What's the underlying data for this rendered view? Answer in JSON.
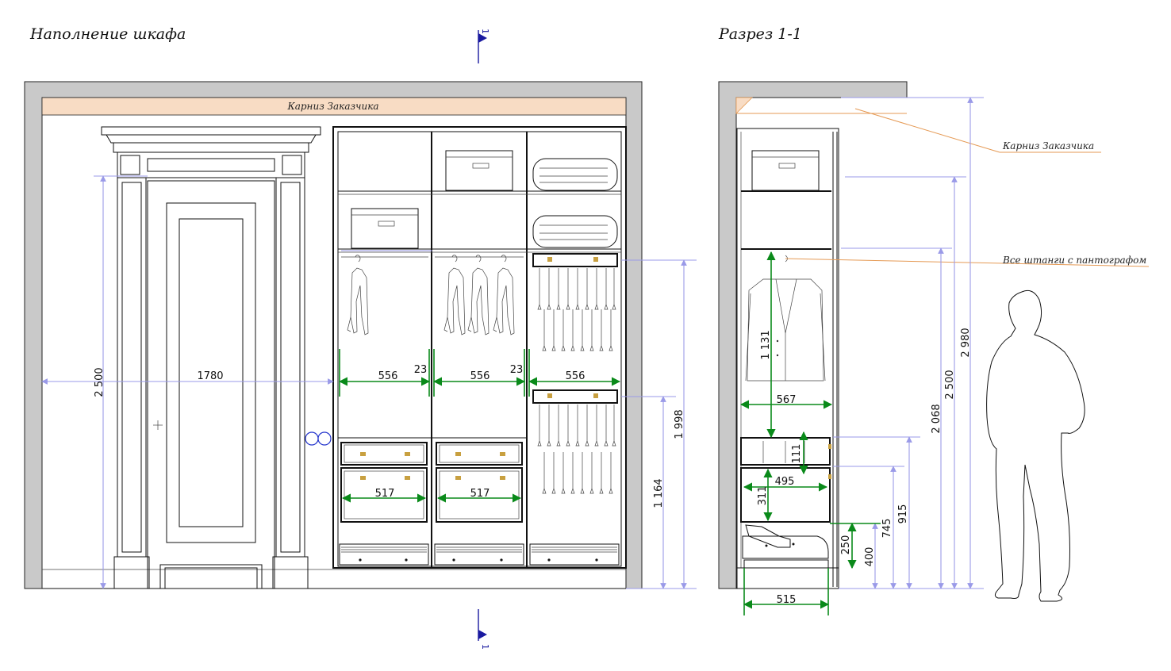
{
  "titles": {
    "elevation": "Наполнение шкафа",
    "section": "Разрез 1-1"
  },
  "section_marker": "1",
  "notes": {
    "cornice_front": "Карниз Заказчика",
    "cornice_side": "Карниз Заказчика",
    "rails": "Все штанги с пантографом"
  },
  "dimensions": {
    "door_height": "2 500",
    "door_width": "1780",
    "bay_1": "556",
    "gap_1": "23",
    "bay_2": "556",
    "gap_2": "23",
    "bay_3": "556",
    "drawer_1": "517",
    "drawer_2": "517",
    "rail_height": "1 998",
    "lower_rail_height": "1 164",
    "section_depth": "567",
    "hang_height": "1 131",
    "small_drawer": "111",
    "inner_depth": "495",
    "drawer_height": "311",
    "shoe_height": "250",
    "base_height": "400",
    "shelf_745": "745",
    "shelf_915": "915",
    "h_2068": "2 068",
    "h_2500": "2 500",
    "h_2980": "2 980",
    "base_depth": "515"
  },
  "colors": {
    "wall": "#c9c9c9",
    "cornice": "#f8dcc4",
    "dimension_green": "#0a8a1a",
    "dimension_blue": "#9a9ae8",
    "leader_orange": "#e59a55",
    "section_marker": "#1a1aa0"
  }
}
